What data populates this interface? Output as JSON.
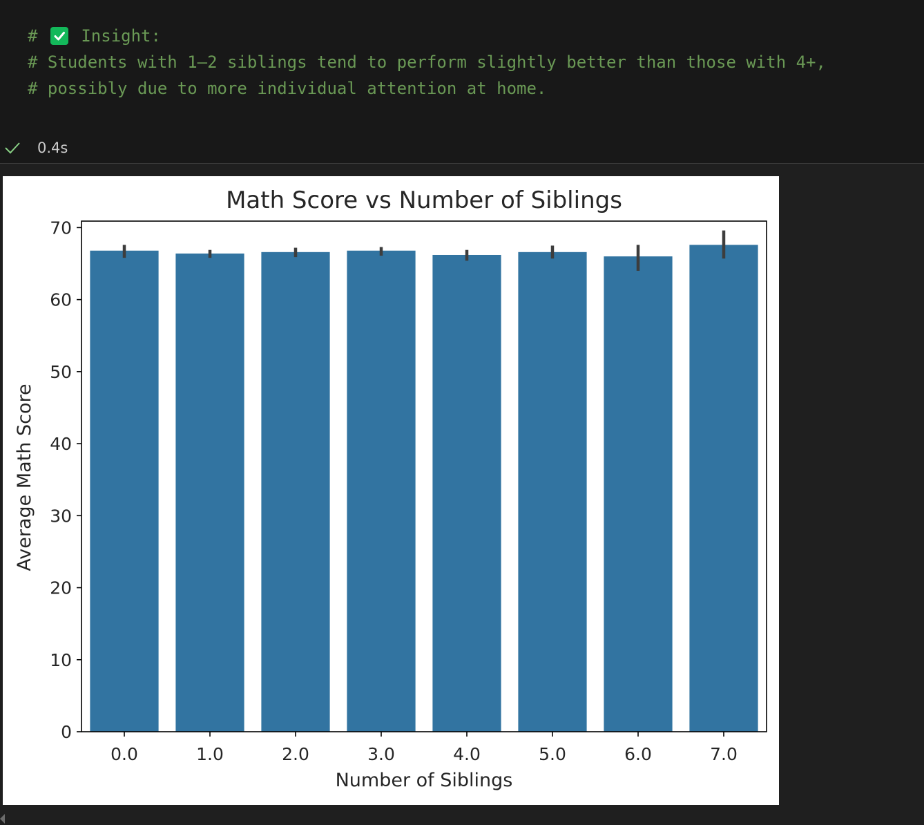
{
  "code": {
    "line1_prefix": "#",
    "line1_label": "Insight:",
    "line2": "# Students with 1–2 siblings tend to perform slightly better than those with 4+,",
    "line3": "# possibly due to more individual attention at home."
  },
  "status": {
    "check_icon": "check-icon",
    "exec_time": "0.4s"
  },
  "colors": {
    "comment": "#6a9955",
    "bar": "#3274a1",
    "checkbox": "#13b85a"
  },
  "chart_data": {
    "type": "bar",
    "title": "Math Score vs Number of Siblings",
    "xlabel": "Number of Siblings",
    "ylabel": "Average Math Score",
    "categories": [
      "0.0",
      "1.0",
      "2.0",
      "3.0",
      "4.0",
      "5.0",
      "6.0",
      "7.0"
    ],
    "values": [
      66.8,
      66.4,
      66.6,
      66.8,
      66.2,
      66.6,
      66.0,
      67.6
    ],
    "error_low": [
      65.8,
      65.8,
      65.9,
      66.1,
      65.4,
      65.7,
      64.0,
      65.7
    ],
    "error_high": [
      67.6,
      66.9,
      67.2,
      67.3,
      66.9,
      67.5,
      67.6,
      69.6
    ],
    "ylim": [
      0,
      70.9
    ],
    "yticks": [
      0,
      10,
      20,
      30,
      40,
      50,
      60,
      70
    ],
    "grid": false,
    "legend": "none"
  }
}
